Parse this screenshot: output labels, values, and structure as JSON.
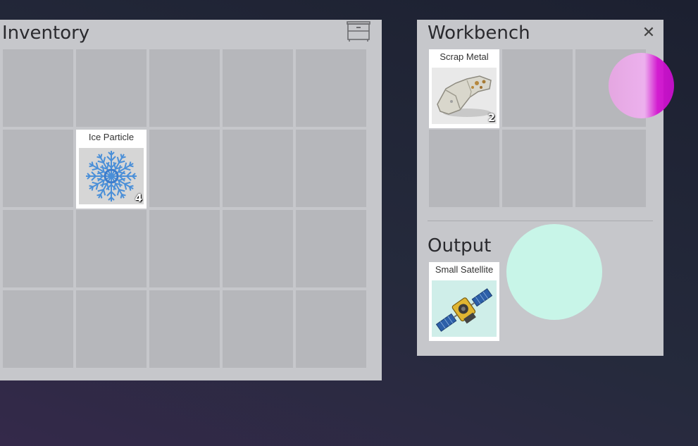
{
  "inventory": {
    "title": "Inventory",
    "storage_icon": "dresser-icon",
    "items": [
      {
        "name": "Ice Particle",
        "count": "4",
        "icon": "snowflake-icon"
      }
    ]
  },
  "workbench": {
    "title": "Workbench",
    "close_label": "✕",
    "items": [
      {
        "name": "Scrap Metal",
        "count": "2",
        "icon": "scrap-metal-icon"
      }
    ]
  },
  "output": {
    "title": "Output",
    "items": [
      {
        "name": "Small Satellite",
        "icon": "satellite-icon"
      }
    ]
  },
  "colors": {
    "panel": "#c6c7cb",
    "slot": "#b6b7bb",
    "magenta_blob": "#e36ae3",
    "mint_blob": "#c8f5e8"
  }
}
